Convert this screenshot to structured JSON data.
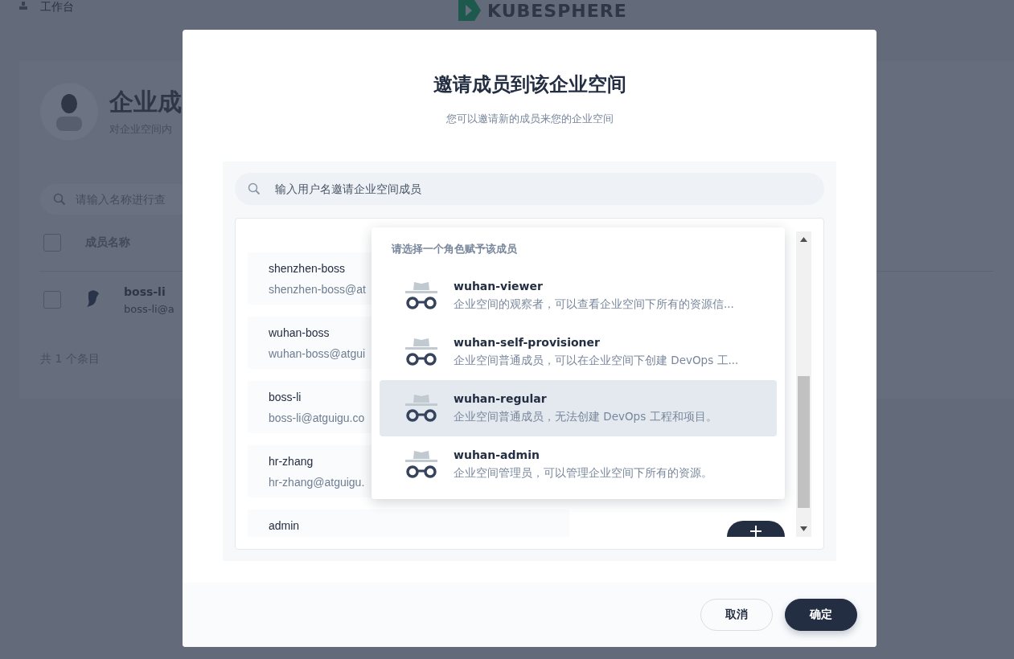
{
  "topbar": {
    "workbench": "工作台",
    "logo": "KUBESPHERE"
  },
  "page_header": {
    "title": "企业成",
    "subtitle": "对企业空间内"
  },
  "members": {
    "search_placeholder": "请输入名称进行查",
    "select_all_checked": false,
    "column": "成员名称",
    "rows": [
      {
        "name": "boss-li",
        "email": "boss-li@a",
        "checked": false
      }
    ],
    "footer": "共 1 个条目"
  },
  "dialog": {
    "title": "邀请成员到该企业空间",
    "subtitle": "您可以邀请新的成员来您的企业空间",
    "search": {
      "placeholder": "输入用户名邀请企业空间成员"
    },
    "users": [
      {
        "name": "shenzhen-boss",
        "email": "shenzhen-boss@at"
      },
      {
        "name": "wuhan-boss",
        "email": "wuhan-boss@atgui"
      },
      {
        "name": "boss-li",
        "email": "boss-li@atguigu.co"
      },
      {
        "name": "hr-zhang",
        "email": "hr-zhang@atguigu."
      },
      {
        "name": "admin"
      }
    ],
    "role_menu": {
      "title": "请选择一个角色赋予该成员",
      "roles": [
        {
          "name": "wuhan-viewer",
          "description": "企业空间的观察者，可以查看企业空间下所有的资源信...",
          "selected": false
        },
        {
          "name": "wuhan-self-provisioner",
          "description": "企业空间普通成员，可以在企业空间下创建 DevOps 工...",
          "selected": false
        },
        {
          "name": "wuhan-regular",
          "description": "企业空间普通成员，无法创建 DevOps 工程和项目。",
          "selected": true
        },
        {
          "name": "wuhan-admin",
          "description": "企业空间管理员，可以管理企业空间下所有的资源。",
          "selected": false
        }
      ]
    },
    "buttons": [
      {
        "label": "取消",
        "kind": "secondary"
      },
      {
        "label": "确定",
        "kind": "primary"
      }
    ]
  }
}
